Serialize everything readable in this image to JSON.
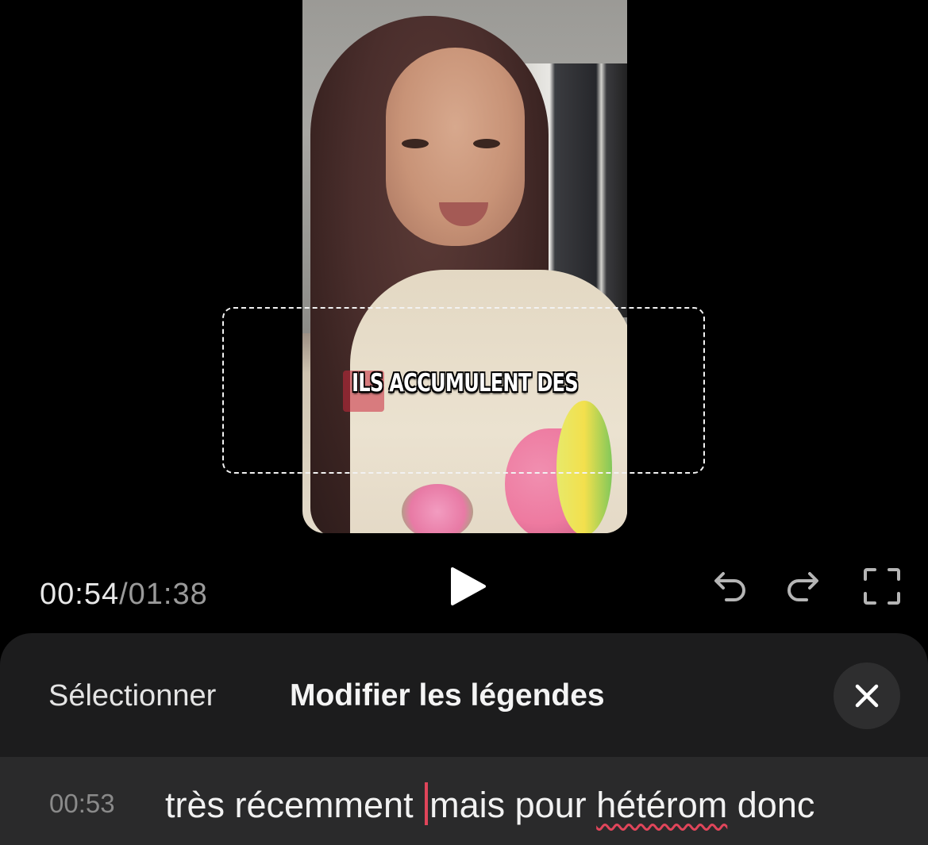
{
  "video": {
    "caption_overlay": "ILS ACCUMULENT DES"
  },
  "player": {
    "current_time": "00:54",
    "separator": "/",
    "total_time": "01:38",
    "play_icon": "play-icon",
    "undo_icon": "undo-icon",
    "redo_icon": "redo-icon",
    "fullscreen_icon": "fullscreen-icon"
  },
  "sheet": {
    "select_label": "Sélectionner",
    "title": "Modifier les légendes",
    "close_icon": "close-icon"
  },
  "captions": [
    {
      "time": "00:53",
      "text_before_cursor": "très récemment ",
      "text_after_cursor": "mais pour ",
      "misspelled_word": "hétérom",
      "text_end": " donc"
    }
  ],
  "colors": {
    "accent": "#e0455a",
    "sheet_bg": "#1c1c1d",
    "row_bg": "#2a2a2b"
  }
}
